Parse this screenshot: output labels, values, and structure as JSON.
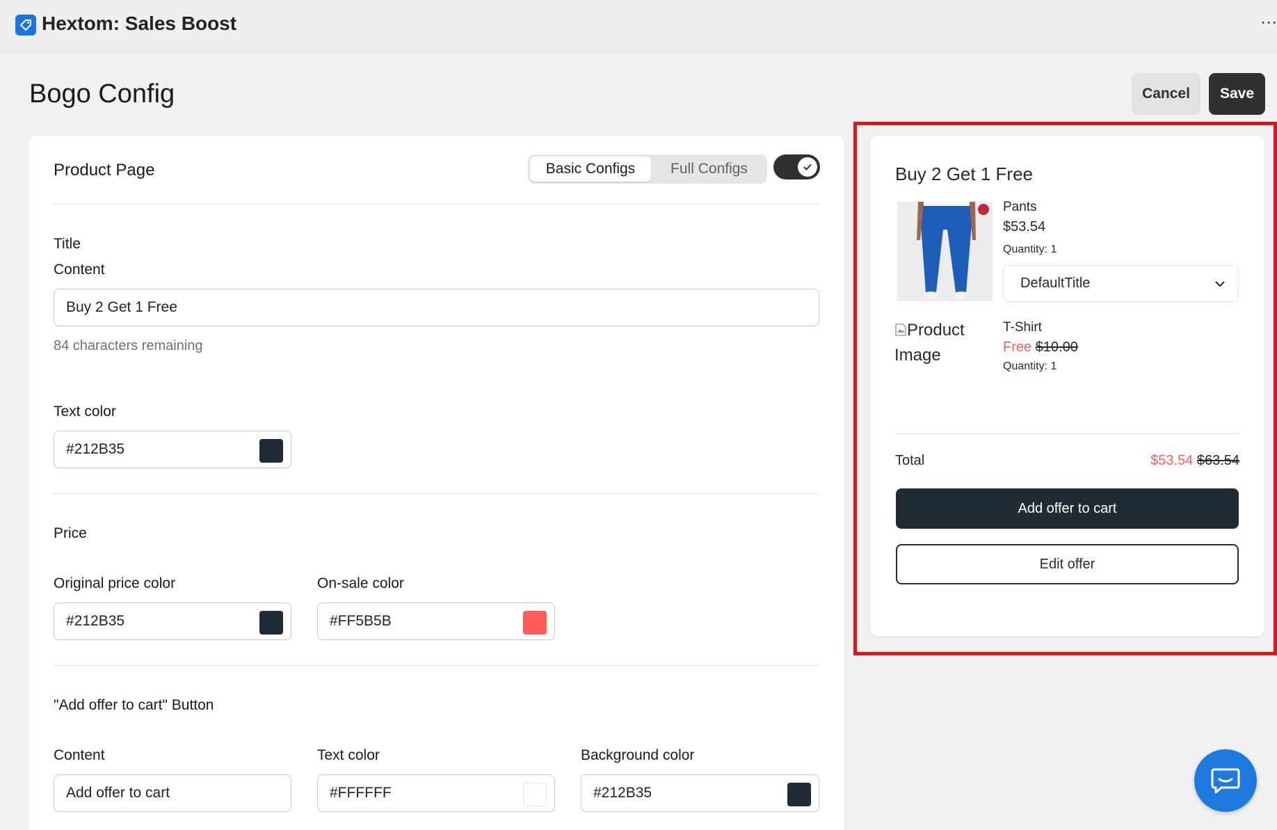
{
  "app": {
    "title": "Hextom: Sales Boost",
    "menu_glyph": "⋯"
  },
  "page": {
    "title": "Bogo Config",
    "cancel_label": "Cancel",
    "save_label": "Save"
  },
  "config": {
    "section_title": "Product Page",
    "tabs": [
      {
        "label": "Basic Configs",
        "selected": true
      },
      {
        "label": "Full Configs",
        "selected": false
      }
    ],
    "enabled": true,
    "title_section": "Title",
    "content_label": "Content",
    "content_value": "Buy 2 Get 1 Free",
    "content_hint": "84 characters remaining",
    "text_color_label": "Text color",
    "text_color_value": "#212B35",
    "price_section": "Price",
    "original_price_color_label": "Original price color",
    "original_price_color_value": "#212B35",
    "on_sale_color_label": "On-sale color",
    "on_sale_color_value": "#FF5B5B",
    "button_section": "\"Add offer to cart\" Button",
    "button_content_label": "Content",
    "button_content_value": "Add offer to cart",
    "button_text_color_label": "Text color",
    "button_text_color_value": "#FFFFFF",
    "button_bg_color_label": "Background color",
    "button_bg_color_value": "#212B35"
  },
  "preview": {
    "title": "Buy 2 Get 1 Free",
    "item1": {
      "name": "Pants",
      "price": "$53.54",
      "quantity": "Quantity: 1",
      "variant": "DefaultTitle"
    },
    "item2": {
      "alt_text": "Product Image",
      "name": "T-Shirt",
      "free_label": "Free",
      "original_price": "$10.00",
      "quantity": "Quantity: 1"
    },
    "total_label": "Total",
    "total_sale": "$53.54",
    "total_original": "$63.54",
    "add_button": "Add offer to cart",
    "edit_button": "Edit offer"
  },
  "colors": {
    "accent": "#1F7AE0",
    "dark": "#212B35",
    "sale": "#FF5B5B",
    "highlight": "#E41212"
  }
}
